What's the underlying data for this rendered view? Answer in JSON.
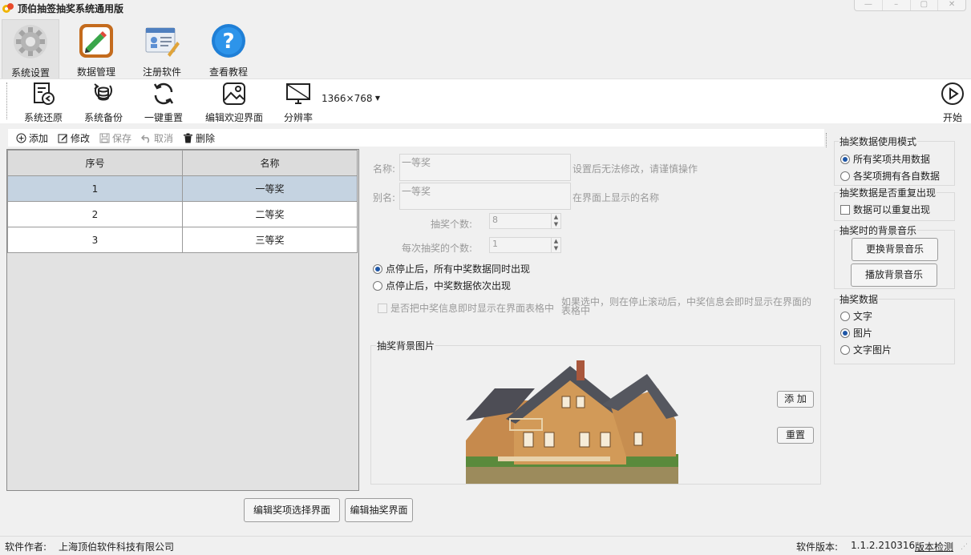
{
  "window": {
    "title": "顶伯抽签抽奖系统通用版",
    "controls": [
      "—",
      "–",
      "▢",
      "✕"
    ]
  },
  "ribbon": {
    "items": [
      {
        "label": "系统设置",
        "icon": "gear-icon"
      },
      {
        "label": "数据管理",
        "icon": "data-edit-icon"
      },
      {
        "label": "注册软件",
        "icon": "register-card-icon"
      },
      {
        "label": "查看教程",
        "icon": "help-icon"
      }
    ]
  },
  "toolbar": {
    "restore": "系统还原",
    "backup": "系统备份",
    "reset": "一键重置",
    "edit_welcome": "编辑欢迎界面",
    "resolution": "分辨率",
    "resolution_value": "1366×768",
    "start": "开始"
  },
  "crud": {
    "add": "添加",
    "edit": "修改",
    "save": "保存",
    "cancel": "取消",
    "delete": "删除"
  },
  "grid": {
    "columns": [
      "序号",
      "名称"
    ],
    "rows": [
      {
        "no": "1",
        "name": "一等奖"
      },
      {
        "no": "2",
        "name": "二等奖"
      },
      {
        "no": "3",
        "name": "三等奖"
      }
    ]
  },
  "form": {
    "name_label": "名称:",
    "name_value": "一等奖",
    "name_hint": "设置后无法修改，请谨慎操作",
    "alias_label": "别名:",
    "alias_value": "一等奖",
    "alias_hint": "在界面上显示的名称",
    "count_label": "抽奖个数:",
    "count_value": "8",
    "per_label": "每次抽奖的个数:",
    "per_value": "1",
    "mode_all": "点停止后，所有中奖数据同时出现",
    "mode_seq": "点停止后，中奖数据依次出现",
    "show_in_table": "是否把中奖信息即时显示在界面表格中",
    "show_hint": "如果选中，则在停止滚动后，中奖信息会即时显示在界面的表格中",
    "bg_title": "抽奖背景图片",
    "bg_add": "添 加",
    "bg_reset": "重置"
  },
  "buttons": {
    "edit_select": "编辑奖项选择界面",
    "edit_draw": "编辑抽奖界面"
  },
  "right": {
    "usage_title": "抽奖数据使用模式",
    "usage_shared": "所有奖项共用数据",
    "usage_own": "各奖项拥有各自数据",
    "repeat_title": "抽奖数据是否重复出现",
    "repeat_check": "数据可以重复出现",
    "music_title": "抽奖时的背景音乐",
    "music_change": "更换背景音乐",
    "music_play": "播放背景音乐",
    "data_title": "抽奖数据",
    "data_text": "文字",
    "data_image": "图片",
    "data_text_image": "文字图片"
  },
  "status": {
    "author_label": "软件作者:",
    "author": "上海顶伯软件科技有限公司",
    "version_label": "软件版本:",
    "version": "1.1.2.210316",
    "check": "版本检测"
  }
}
